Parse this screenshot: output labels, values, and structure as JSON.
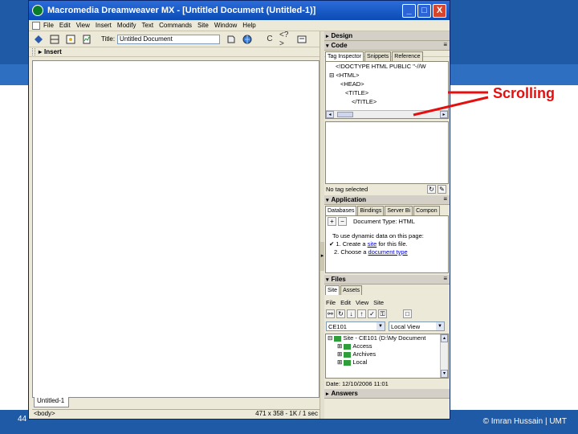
{
  "window": {
    "title": "Macromedia Dreamweaver MX - [Untitled Document (Untitled-1)]",
    "buttons": {
      "minimize": "_",
      "maximize": "□",
      "close": "X"
    }
  },
  "menu": [
    "File",
    "Edit",
    "View",
    "Insert",
    "Modify",
    "Text",
    "Commands",
    "Site",
    "Window",
    "Help"
  ],
  "toolbar": {
    "title_label": "Title:",
    "title_value": "Untitled Document",
    "refresh": "C",
    "code_nav": "<?>"
  },
  "insert_panel": {
    "label": "Insert"
  },
  "document": {
    "tab_label": "Untitled-1",
    "tag_selector": "<body>",
    "size_info": "471 x 358 - 1K / 1 sec"
  },
  "design_panel": {
    "label": "Design",
    "code_label": "Code",
    "tabs": [
      "Tag Inspector",
      "Snippets",
      "Reference"
    ],
    "code_lines": [
      "<!DOCTYPE HTML PUBLIC \"-//W",
      "<HTML>",
      "<HEAD>",
      "<TITLE>",
      "</TITLE>"
    ],
    "status": "No tag selected"
  },
  "application_panel": {
    "label": "Application",
    "tabs": [
      "Databases",
      "Bindings",
      "Server Bi",
      "Compon"
    ],
    "doc_type": "Document Type: HTML",
    "intro": "To use dynamic data on this page:",
    "step1_prefix": "1. Create a ",
    "step1_link": "site",
    "step1_suffix": " for this file.",
    "step2_prefix": "2. Choose a ",
    "step2_link": "document type"
  },
  "files_panel": {
    "label": "Files",
    "tabs": [
      "Site",
      "Assets"
    ],
    "menus": [
      "File",
      "Edit",
      "View",
      "Site"
    ],
    "site_select": "CE101",
    "view_select": "Local View",
    "tree": [
      "Site - CE101 (D:\\My Document",
      "Access",
      "Archives",
      "Local"
    ],
    "date": "Date: 12/10/2006 11:01"
  },
  "answers_panel": {
    "label": "Answers"
  },
  "slide": {
    "callout": "Scrolling",
    "slide_number": "44",
    "footer": "© Imran Hussain | UMT"
  },
  "colors": {
    "callout": "#e41010",
    "titlebar": "#0a4bb6",
    "panel_bg": "#ece9d8"
  }
}
